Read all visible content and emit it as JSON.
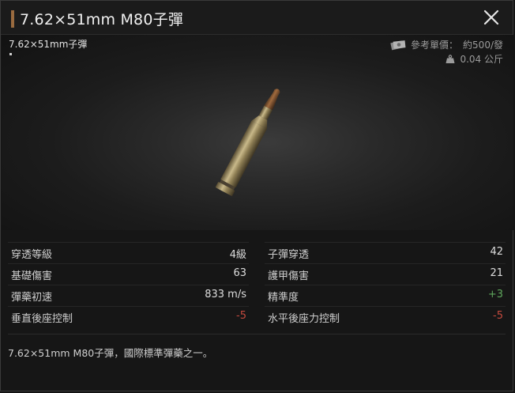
{
  "window": {
    "title": "7.62×51mm M80子彈",
    "close_icon": "close-icon"
  },
  "preview": {
    "item_name": "7.62×51mm子彈",
    "price_label": "參考單價：",
    "price_value": "約500/發",
    "weight_value": "0.04 公斤",
    "price_icon": "money-icon",
    "weight_icon": "weight-icon"
  },
  "stats": {
    "left": [
      {
        "label": "穿透等級",
        "value": "4級",
        "tone": "normal"
      },
      {
        "label": "基礎傷害",
        "value": "63",
        "tone": "normal"
      },
      {
        "label": "彈藥初速",
        "value": "833 m/s",
        "tone": "normal"
      },
      {
        "label": "垂直後座控制",
        "value": "-5",
        "tone": "negative"
      }
    ],
    "right": [
      {
        "label": "子彈穿透",
        "value": "42",
        "tone": "normal"
      },
      {
        "label": "護甲傷害",
        "value": "21",
        "tone": "normal"
      },
      {
        "label": "精準度",
        "value": "+3",
        "tone": "positive"
      },
      {
        "label": "水平後座力控制",
        "value": "-5",
        "tone": "negative"
      }
    ]
  },
  "description": "7.62×51mm M80子彈，國際標準彈藥之一。",
  "colors": {
    "accent": "#9a6b3f",
    "negative": "#c44a3e",
    "positive": "#5fa85d"
  }
}
